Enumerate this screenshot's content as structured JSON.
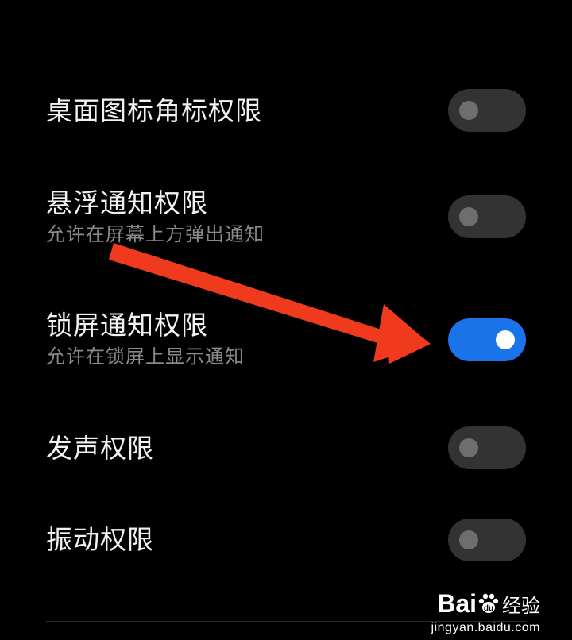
{
  "settings": [
    {
      "title": "桌面图标角标权限",
      "subtitle": "",
      "enabled": false
    },
    {
      "title": "悬浮通知权限",
      "subtitle": "允许在屏幕上方弹出通知",
      "enabled": false
    },
    {
      "title": "锁屏通知权限",
      "subtitle": "允许在锁屏上显示通知",
      "enabled": true
    },
    {
      "title": "发声权限",
      "subtitle": "",
      "enabled": false
    },
    {
      "title": "振动权限",
      "subtitle": "",
      "enabled": false
    }
  ],
  "colors": {
    "background": "#000000",
    "toggle_on": "#1a73e8",
    "toggle_off": "#333333",
    "annotation_arrow": "#f03a1e"
  },
  "watermark": {
    "brand_latin_a": "Bai",
    "brand_latin_b": "",
    "brand_cn": "经验",
    "url": "jingyan.baidu.com"
  }
}
